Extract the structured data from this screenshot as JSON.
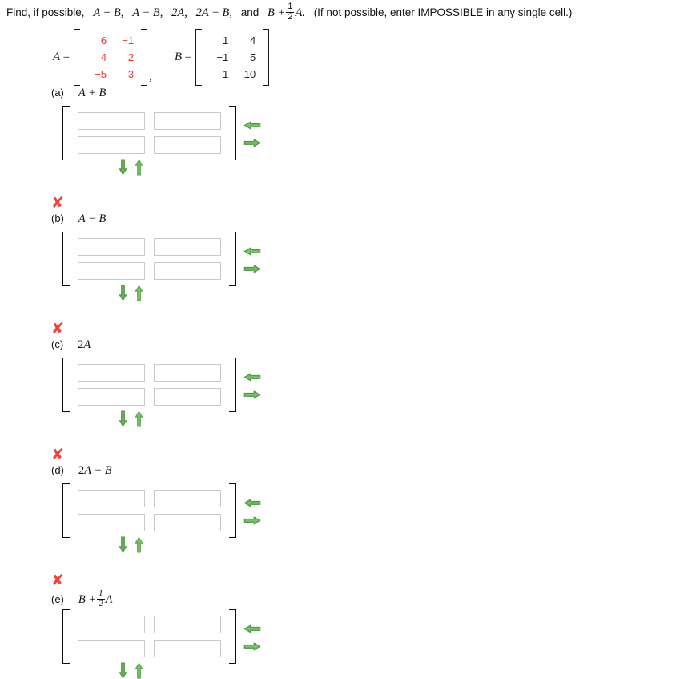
{
  "prompt": {
    "lead": "Find, if possible,",
    "items": [
      "A + B,",
      "A − B,",
      "2A,",
      "2A − B,"
    ],
    "and": "and",
    "last_base": "B +",
    "last_frac_num": "1",
    "last_frac_den": "2",
    "last_var": "A.",
    "note": "(If not possible, enter IMPOSSIBLE in any single cell.)"
  },
  "given": {
    "matrix_a": {
      "name": "A",
      "equals": "=",
      "color": "#e8352b",
      "rows": [
        [
          "6",
          "−1"
        ],
        [
          "4",
          "2"
        ],
        [
          "−5",
          "3"
        ]
      ]
    },
    "separator": ",",
    "matrix_b": {
      "name": "B",
      "equals": "=",
      "color": "#222222",
      "rows": [
        [
          "1",
          "4"
        ],
        [
          "−1",
          "5"
        ],
        [
          "1",
          "10"
        ]
      ]
    }
  },
  "icons": {
    "incorrect": "✘",
    "arrow_left": "arrow-left-icon",
    "arrow_right": "arrow-right-icon",
    "arrow_down": "arrow-down-icon",
    "arrow_up": "arrow-up-icon"
  },
  "colors": {
    "incorrect_mark": "#e8453c",
    "matrix_a_values": "#e8352b",
    "arrow_green_dark": "#4e9a44",
    "arrow_green_light": "#7dc06a",
    "input_border": "#c8c8c8"
  },
  "parts": [
    {
      "tag": "(a)",
      "expr_html": "A + B",
      "incorrect": false,
      "cells": [
        [
          "",
          ""
        ],
        [
          "",
          ""
        ]
      ],
      "placeholder": ""
    },
    {
      "tag": "(b)",
      "expr_html": "A − B",
      "incorrect": true,
      "cells": [
        [
          "",
          ""
        ],
        [
          "",
          ""
        ]
      ],
      "placeholder": ""
    },
    {
      "tag": "(c)",
      "expr_html": "2A",
      "incorrect": true,
      "cells": [
        [
          "",
          ""
        ],
        [
          "",
          ""
        ]
      ],
      "placeholder": ""
    },
    {
      "tag": "(d)",
      "expr_html": "2A − B",
      "incorrect": true,
      "cells": [
        [
          "",
          ""
        ],
        [
          "",
          ""
        ]
      ],
      "placeholder": ""
    },
    {
      "tag": "(e)",
      "expr_html": "B + 1/2 A",
      "incorrect": true,
      "cells": [
        [
          "",
          ""
        ],
        [
          "",
          ""
        ]
      ],
      "placeholder": ""
    }
  ]
}
